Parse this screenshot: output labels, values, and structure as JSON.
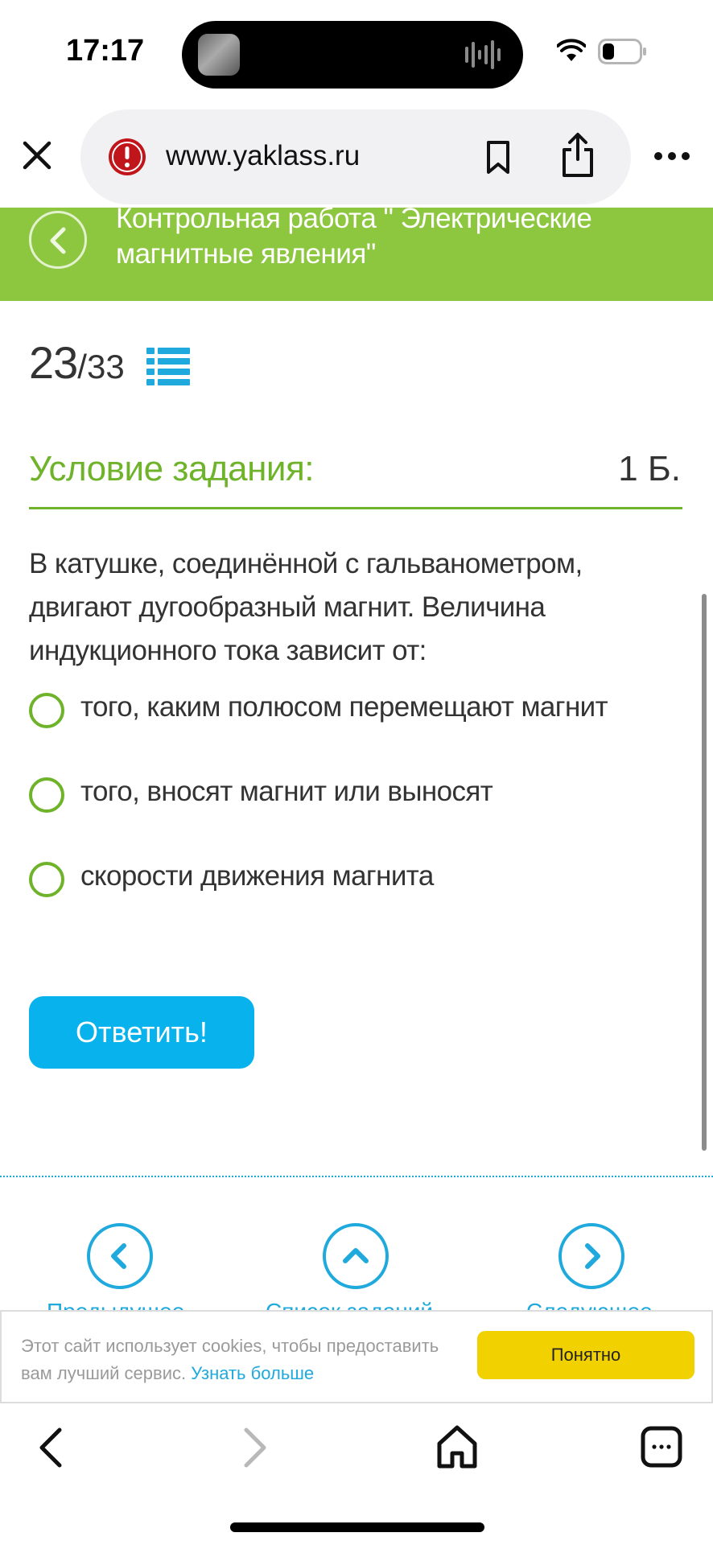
{
  "status_bar": {
    "time": "17:17"
  },
  "browser": {
    "url": "www.yaklass.ru"
  },
  "header": {
    "title": "Контрольная работа \" Электрические магнитные явления\""
  },
  "progress": {
    "current": "23",
    "total": "/33"
  },
  "condition": {
    "title": "Условие задания:",
    "points": "1 Б."
  },
  "question": {
    "text": "В катушке, соединённой с гальванометром, двигают дугообразный магнит. Величина индукционного тока зависит от:",
    "options": [
      "того, каким полюсом перемещают магнит",
      "того, вносят магнит или выносят",
      "скорости движения магнита"
    ]
  },
  "actions": {
    "answer_label": "Ответить!"
  },
  "bottom_nav": {
    "prev_label": "Предыдущее",
    "list_label": "Список заданий",
    "next_label": "Следующее"
  },
  "cookie": {
    "text": "Этот сайт использует cookies, чтобы предоставить вам лучший сервис.",
    "link": "Узнать больше",
    "button": "Понятно"
  },
  "colors": {
    "brand_green": "#8dc63f",
    "title_green": "#6fb32b",
    "accent_blue": "#08b2ec",
    "link_blue": "#1fa9dc",
    "cookie_yellow": "#f2d100"
  }
}
